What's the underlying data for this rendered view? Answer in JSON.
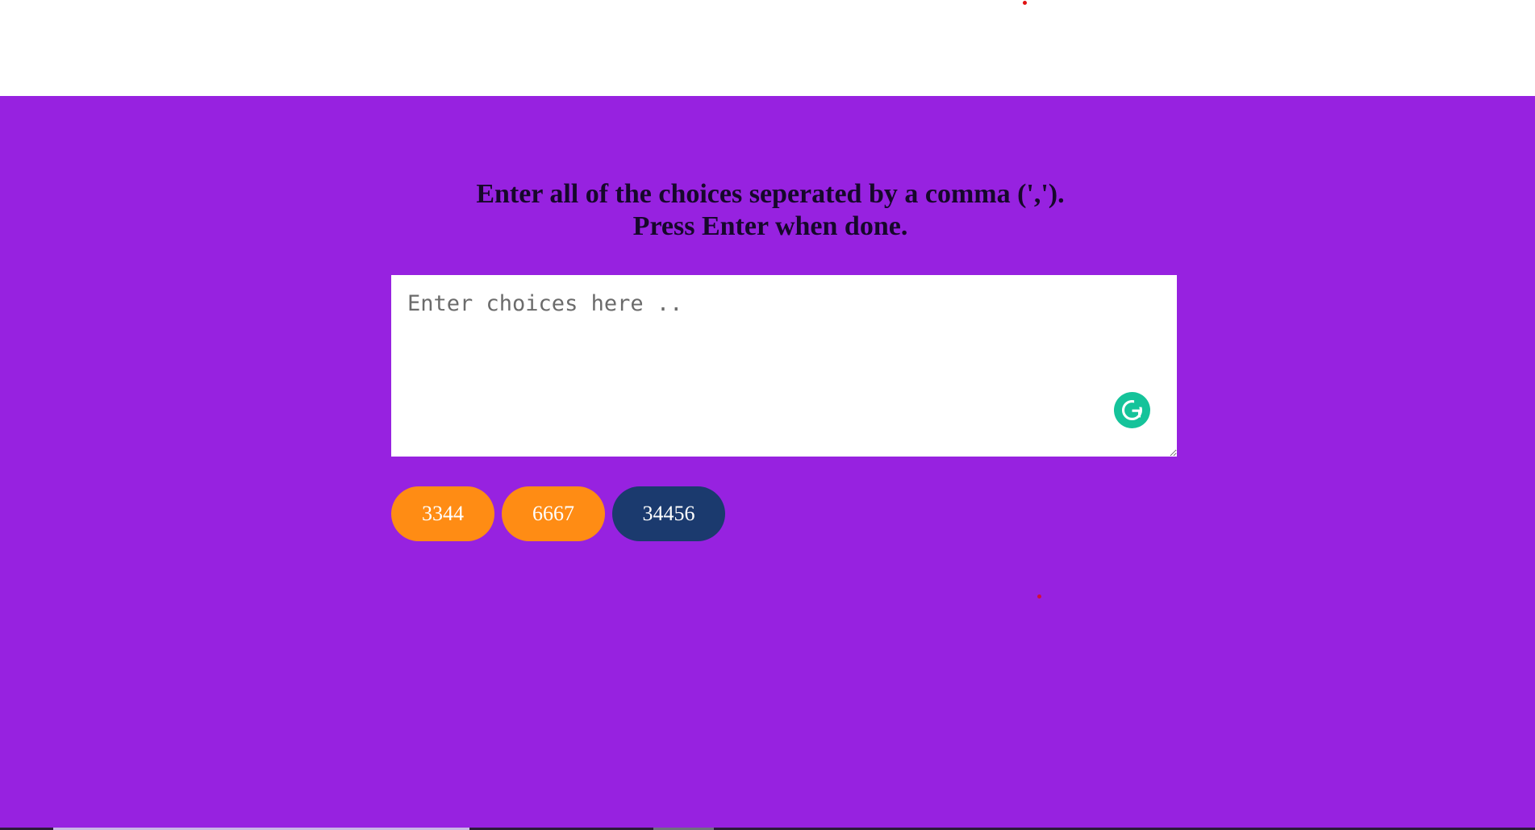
{
  "page": {
    "background_color": "#9722e0",
    "heading_line_1": "Enter all of the choices seperated by a comma (',').",
    "heading_line_2": "Press Enter when done."
  },
  "choices_input": {
    "value": "",
    "placeholder": "Enter choices here .."
  },
  "grammarly_badge": {
    "icon": "grammarly-icon",
    "color": "#15c39a"
  },
  "choices": [
    {
      "label": "3344",
      "color": "#ff8c14"
    },
    {
      "label": "6667",
      "color": "#ff8c14"
    },
    {
      "label": "34456",
      "color": "#1b3a6e"
    }
  ]
}
